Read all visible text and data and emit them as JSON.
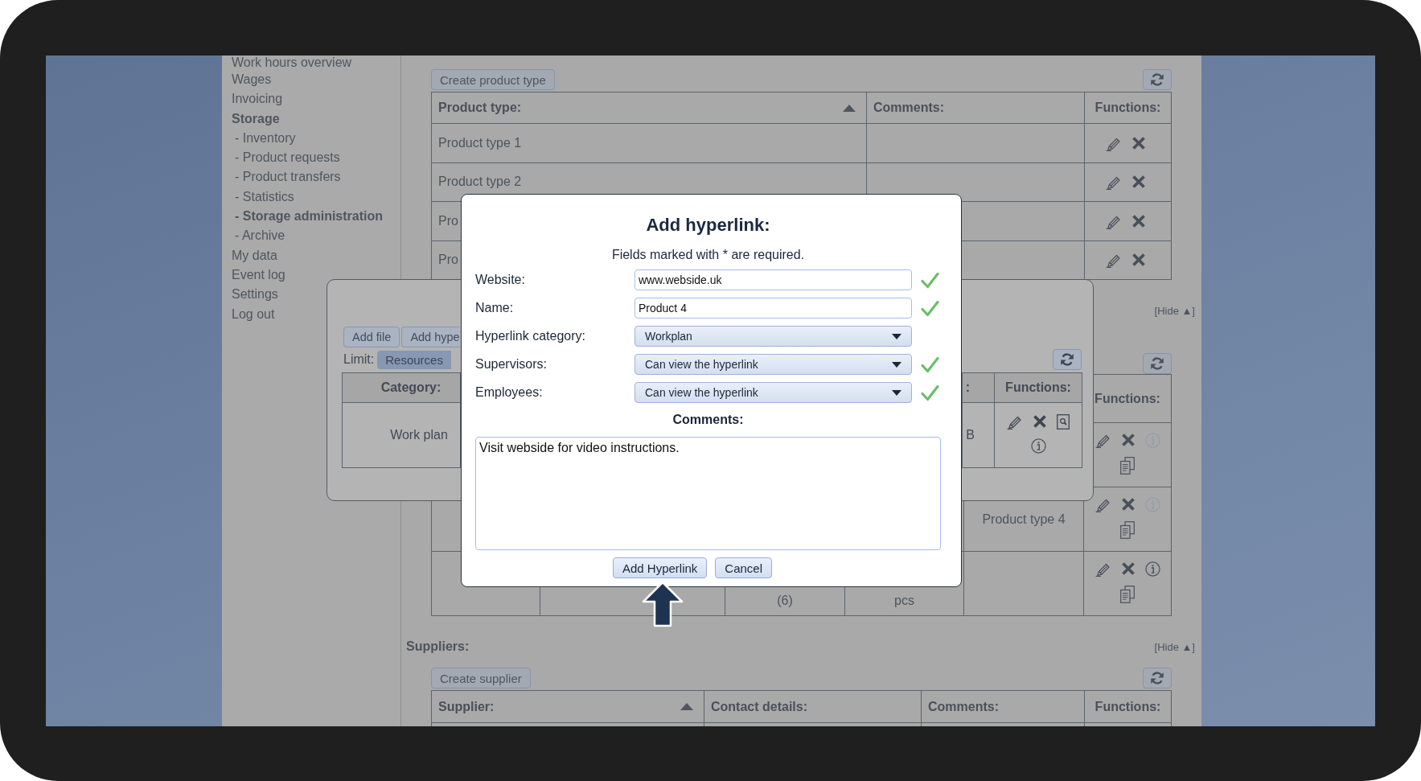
{
  "sidebar": {
    "items": [
      {
        "label": "Work hours overview",
        "selected": false
      },
      {
        "label": "Wages",
        "selected": false
      },
      {
        "label": "Invoicing",
        "selected": false
      },
      {
        "label": "Storage",
        "selected": true,
        "children": [
          {
            "label": "- Inventory",
            "selected": false
          },
          {
            "label": "- Product requests",
            "selected": false
          },
          {
            "label": "- Product transfers",
            "selected": false
          },
          {
            "label": "- Statistics",
            "selected": false
          },
          {
            "label": "- Storage administration",
            "selected": true
          },
          {
            "label": "- Archive",
            "selected": false
          }
        ]
      },
      {
        "label": "My data",
        "selected": false
      },
      {
        "label": "Event log",
        "selected": false
      },
      {
        "label": "Settings",
        "selected": false
      },
      {
        "label": "Log out",
        "selected": false
      }
    ]
  },
  "sections": [
    {
      "create_button": "Create product type",
      "table": {
        "kind": "standard",
        "columns": [
          {
            "label": "Product type:",
            "sorted": true
          },
          {
            "label": "Comments:",
            "sorted": false
          },
          {
            "label": "Functions:",
            "sorted": false
          }
        ],
        "rows": [
          {
            "cells": [
              "Product type 1"
            ]
          },
          {
            "cells": [
              "Product type 2"
            ]
          },
          {
            "cells": [
              "Pro"
            ]
          },
          {
            "cells": [
              "Pro"
            ]
          }
        ]
      }
    },
    {
      "hide_link": "[Hide ▲]",
      "table": {
        "kind": "stock",
        "functions_header": "Functions:",
        "rows": [
          {
            "info_enabled": false
          },
          {
            "column_5": "Product type 4",
            "info_enabled": false
          },
          {
            "column_3": "(6)",
            "column_4": "pcs",
            "info_enabled": true
          }
        ]
      }
    },
    {
      "title": "Suppliers:",
      "hide_link": "[Hide ▲]",
      "create_button": "Create supplier",
      "table": {
        "kind": "standard",
        "columns": [
          {
            "label": "Supplier:",
            "sorted": true
          },
          {
            "label": "Contact details:",
            "sorted": false
          },
          {
            "label": "Comments:",
            "sorted": false
          },
          {
            "label": "Functions:",
            "sorted": false
          }
        ]
      }
    }
  ],
  "file_dialog": {
    "buttons": [
      "Add file",
      "Add hype"
    ],
    "limit_label": "Limit:",
    "limit_options": [
      {
        "label": "Resources",
        "selected": true
      }
    ],
    "table": {
      "columns": [
        {
          "label": "Category:"
        },
        {
          "label": ":"
        },
        {
          "label": "Functions:"
        }
      ],
      "rows": [
        {
          "cells": [
            "Work plan",
            "B"
          ]
        }
      ]
    }
  },
  "hyperlink_dialog": {
    "title": "Add hyperlink:",
    "note": "Fields marked with * are required.",
    "fields": [
      {
        "label": "Website:",
        "kind": "text",
        "value": "www.webside.uk",
        "valid": true
      },
      {
        "label": "Name:",
        "kind": "text",
        "value": "Product 4",
        "valid": true
      },
      {
        "label": "Hyperlink category:",
        "kind": "select",
        "value": "Workplan",
        "valid": false
      },
      {
        "label": "Supervisors:",
        "kind": "select",
        "value": "Can view the hyperlink",
        "valid": true
      },
      {
        "label": "Employees:",
        "kind": "select",
        "value": "Can view the hyperlink",
        "valid": true
      }
    ],
    "comments_label": "Comments:",
    "comments": "Visit webside for video instructions.",
    "buttons": [
      "Add Hyperlink",
      "Cancel"
    ]
  }
}
